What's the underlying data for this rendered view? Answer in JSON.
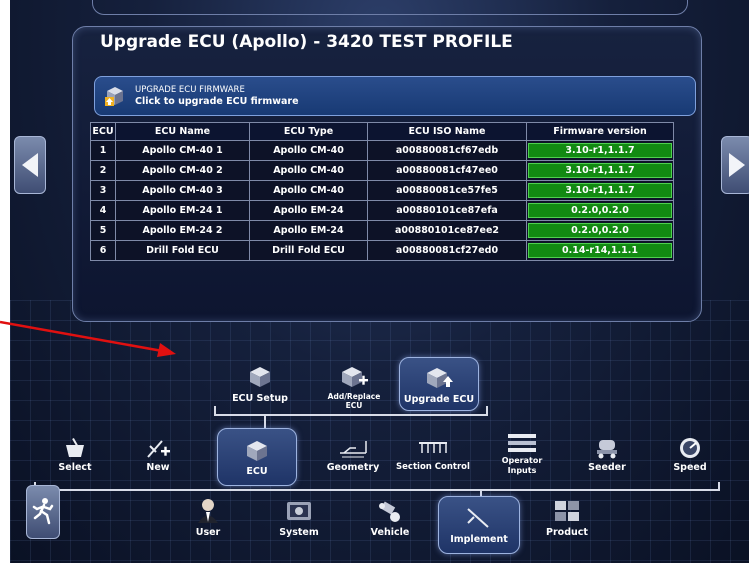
{
  "page_title": "Upgrade ECU (Apollo) - 3420 TEST PROFILE",
  "firmware_bar": {
    "title": "UPGRADE ECU FIRMWARE",
    "subtitle": "Click to upgrade ECU firmware"
  },
  "table": {
    "headers": [
      "ECU",
      "ECU Name",
      "ECU Type",
      "ECU ISO Name",
      "Firmware version"
    ],
    "rows": [
      [
        "1",
        "Apollo CM-40 1",
        "Apollo CM-40",
        "a00880081cf67edb",
        "3.10-r1,1.1.7"
      ],
      [
        "2",
        "Apollo CM-40 2",
        "Apollo CM-40",
        "a00880081cf47ee0",
        "3.10-r1,1.1.7"
      ],
      [
        "3",
        "Apollo CM-40 3",
        "Apollo CM-40",
        "a00880081ce57fe5",
        "3.10-r1,1.1.7"
      ],
      [
        "4",
        "Apollo EM-24 1",
        "Apollo EM-24",
        "a00880101ce87efa",
        "0.2.0,0.2.0"
      ],
      [
        "5",
        "Apollo EM-24 2",
        "Apollo EM-24",
        "a00880101ce87ee2",
        "0.2.0,0.2.0"
      ],
      [
        "6",
        "Drill Fold ECU",
        "Drill Fold ECU",
        "a00880081cf27ed0",
        "0.14-r14,1.1.1"
      ]
    ]
  },
  "ecu_submenu": {
    "ecu_setup": "ECU Setup",
    "add_replace_1": "Add/Replace",
    "add_replace_2": "ECU",
    "upgrade_ecu": "Upgrade ECU"
  },
  "implement_menu": {
    "select": "Select",
    "new": "New",
    "ecu": "ECU",
    "geometry": "Geometry",
    "section_control": "Section Control",
    "operator_inputs_1": "Operator",
    "operator_inputs_2": "Inputs",
    "seeder": "Seeder",
    "speed": "Speed"
  },
  "main_menu": {
    "user": "User",
    "system": "System",
    "vehicle": "Vehicle",
    "implement": "Implement",
    "product": "Product"
  },
  "colors": {
    "firmware_cell": "#128a12",
    "callout_arrow": "#e01010",
    "panel_border": "#6e7ea8"
  }
}
